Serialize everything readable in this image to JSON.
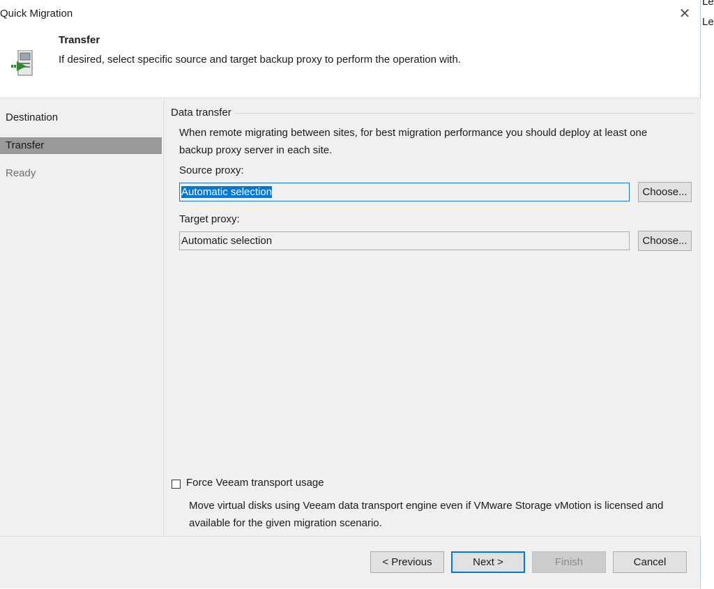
{
  "window": {
    "title": "Quick Migration"
  },
  "background": {
    "line1": "Leg",
    "line2": "Leg"
  },
  "header": {
    "title": "Transfer",
    "description": "If desired, select specific source and target backup proxy to perform the operation with.",
    "icon": "migration-server-icon"
  },
  "sidebar": {
    "items": [
      {
        "label": "Destination",
        "state": "normal"
      },
      {
        "label": "Transfer",
        "state": "selected"
      },
      {
        "label": "Ready",
        "state": "disabled"
      }
    ]
  },
  "content": {
    "group_label": "Data transfer",
    "info_line1": "When remote migrating between sites, for best migration performance you should deploy at least one",
    "info_line2": "backup proxy server in each site.",
    "source_proxy": {
      "label": "Source proxy:",
      "value": "Automatic selection",
      "button": "Choose..."
    },
    "target_proxy": {
      "label": "Target proxy:",
      "value": "Automatic selection",
      "button": "Choose..."
    },
    "force_transport": {
      "label": "Force Veeam transport usage",
      "checked": false,
      "description_line1": "Move virtual disks using Veeam data transport engine even if VMware Storage vMotion is licensed and",
      "description_line2": "available for the given migration scenario."
    }
  },
  "footer": {
    "previous": "< Previous",
    "next": "Next >",
    "finish": "Finish",
    "cancel": "Cancel"
  },
  "colors": {
    "selection": "#0078d7",
    "sidebar_selected": "#999999",
    "panel_bg": "#f0f0f0"
  }
}
